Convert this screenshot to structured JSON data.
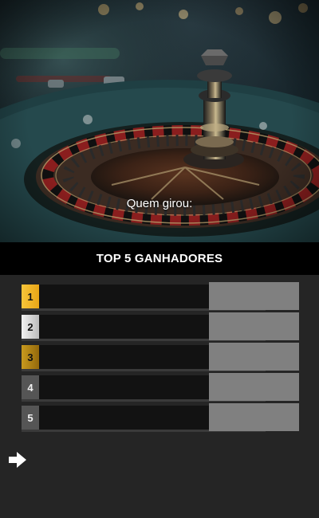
{
  "hero": {
    "caption": "Quem girou:"
  },
  "leaderboard": {
    "title": "TOP 5 GANHADORES",
    "entries": [
      {
        "rank": "1",
        "badge_color": "#f2b523"
      },
      {
        "rank": "2",
        "badge_color": "#d8d8d8"
      },
      {
        "rank": "3",
        "badge_color": "#b38414"
      },
      {
        "rank": "4",
        "badge_color": "#555555"
      },
      {
        "rank": "5",
        "badge_color": "#555555"
      }
    ]
  },
  "navigation": {
    "next_icon": "arrow-right-icon"
  },
  "colors": {
    "background": "#252525",
    "title_bar": "#000000",
    "row_track": "#121212",
    "score_box": "#808080"
  }
}
